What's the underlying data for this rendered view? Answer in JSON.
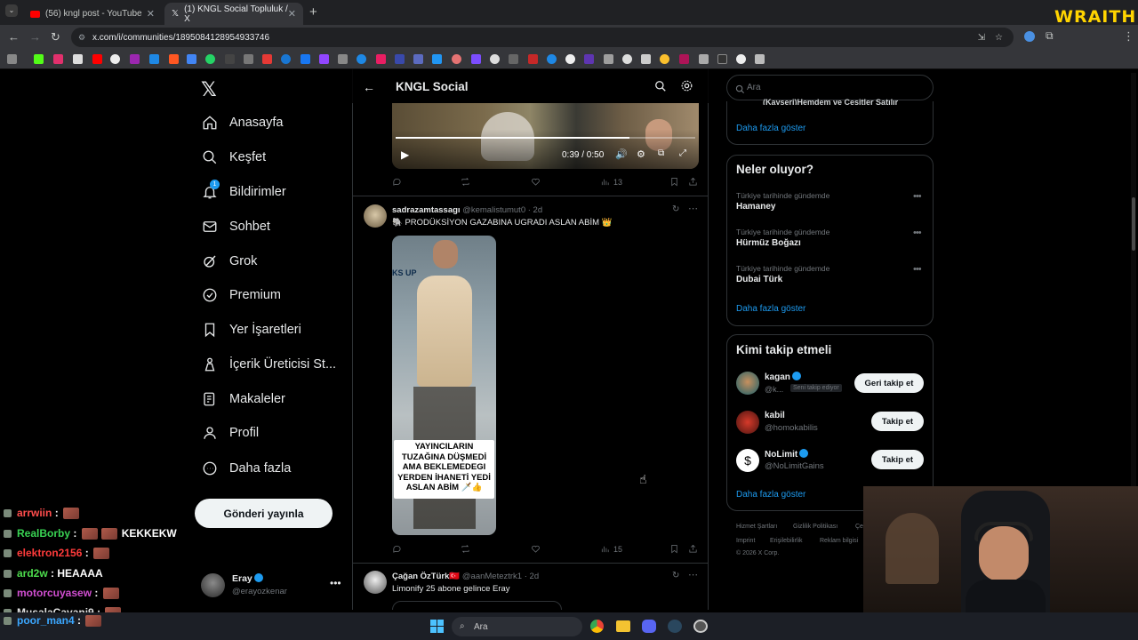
{
  "browser": {
    "tabs": [
      {
        "label": "(56) kngl post - YouTube",
        "active": false
      },
      {
        "label": "(1) KNGL Social Topluluk / X",
        "active": true
      }
    ],
    "url": "x.com/i/communities/1895084128954933746",
    "overlay_logo": "WRAITH"
  },
  "nav": {
    "items": [
      {
        "label": "Anasayfa",
        "icon": "home-icon"
      },
      {
        "label": "Keşfet",
        "icon": "search-icon"
      },
      {
        "label": "Bildirimler",
        "icon": "bell-icon",
        "badge": "1"
      },
      {
        "label": "Sohbet",
        "icon": "mail-icon"
      },
      {
        "label": "Grok",
        "icon": "grok-icon"
      },
      {
        "label": "Premium",
        "icon": "premium-icon"
      },
      {
        "label": "Yer İşaretleri",
        "icon": "bookmark-icon"
      },
      {
        "label": "İçerik Üreticisi St...",
        "icon": "creator-icon"
      },
      {
        "label": "Makaleler",
        "icon": "articles-icon"
      },
      {
        "label": "Profil",
        "icon": "profile-icon"
      },
      {
        "label": "Daha fazla",
        "icon": "more-circle-icon"
      }
    ],
    "post_button": "Gönderi yayınla",
    "account": {
      "name": "Eray",
      "handle": "@erayozkenar"
    }
  },
  "header": {
    "title": "KNGL Social"
  },
  "video": {
    "time": "0:39 / 0:50",
    "progress": 0.78,
    "views": "13"
  },
  "posts": [
    {
      "name": "sadrazamtassagı",
      "handle": "@kemalistumut0",
      "age": "· 2d",
      "text": "🐘 PRODÜKSİYON GAZABINA UGRADI ASLAN ABİM 👑",
      "image_caption": "YAYINCILARIN TUZAĞINA DÜŞMEDİ AMA BEKLEMEDEGI YERDEN İHANETİ YEDİ ASLAN ABİM 🗡️👍",
      "image_sign": "KS UP",
      "views": "15"
    },
    {
      "name": "Çağan ÖzTürk",
      "flag": "🇹🇷",
      "handle": "@aanMeteztrk1",
      "age": "· 2d",
      "text": "Limonify 25 abone gelince Eray"
    }
  ],
  "right": {
    "search_placeholder": "Ara",
    "top_partial": "(Kayseri)Hemdem ve Çeşitler Satılır",
    "show_more": "Daha fazla göster",
    "trending_title": "Neler oluyor?",
    "trends": [
      {
        "context": "Türkiye tarihinde gündemde",
        "name": "Hamaney"
      },
      {
        "context": "Türkiye tarihinde gündemde",
        "name": "Hürmüz Boğazı"
      },
      {
        "context": "Türkiye tarihinde gündemde",
        "name": "Dubai Türk"
      }
    ],
    "who_to_follow_title": "Kimi takip etmeli",
    "suggestions": [
      {
        "name": "kagan",
        "handle": "@k...",
        "follows_you": "Seni takip ediyor",
        "button": "Geri takip et",
        "verified": true
      },
      {
        "name": "kabil",
        "handle": "@homokabilis",
        "button": "Takip et",
        "verified": false
      },
      {
        "name": "NoLimit",
        "handle": "@NoLimitGains",
        "button": "Takip et",
        "verified": true
      }
    ],
    "footer": [
      "Hizmet Şartları",
      "Gizlilik Politikası",
      "Çe",
      "Imprint",
      "Erişilebilirlik",
      "Reklam bilgisi",
      "© 2026 X Corp."
    ]
  },
  "chat": [
    {
      "user": "arrwiin",
      "color": "#ff4d4d",
      "message": ""
    },
    {
      "user": "RealBorby",
      "color": "#39d353",
      "message": "KEKKEKW"
    },
    {
      "user": "elektron2156",
      "color": "#ff3b3b",
      "message": ""
    },
    {
      "user": "ard2w",
      "color": "#4ddc4d",
      "message": "HEAAAA"
    },
    {
      "user": "motorcuyasew",
      "color": "#d04ed0",
      "message": ""
    },
    {
      "user": "MusalaCavani9",
      "color": "#e0e0e0",
      "message": ""
    },
    {
      "user": "poor_man4",
      "color": "#3ba7ff",
      "message": ""
    }
  ],
  "taskbar": {
    "search": "Ara"
  }
}
